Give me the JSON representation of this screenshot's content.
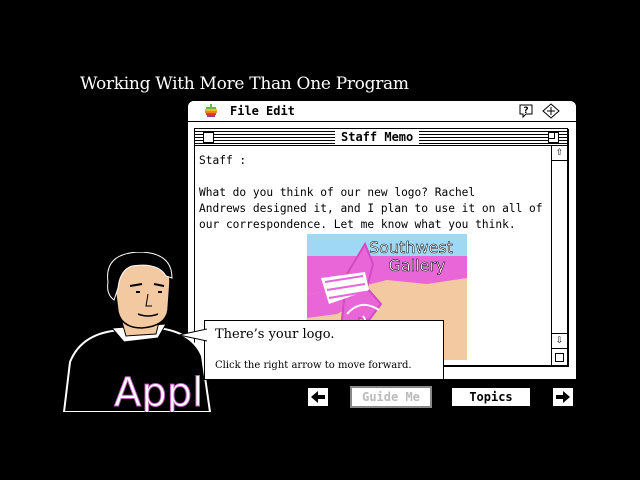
{
  "heading": "Working With More Than One Program",
  "menubar": {
    "file": "File",
    "edit": "Edit"
  },
  "document": {
    "title": "Staff Memo",
    "lines": [
      "Staff :",
      "",
      "What do you think of our new logo?  Rachel",
      "Andrews designed it, and I plan to use it on all of",
      "our correspondence.  Let me know what you think."
    ]
  },
  "logo": {
    "line1": "Southwest",
    "line2": "Gallery"
  },
  "character": {
    "shirt_text": "Appl"
  },
  "bubble": {
    "main": "There’s your logo.",
    "sub": "Click the right arrow to move forward."
  },
  "nav": {
    "guide_me": "Guide Me",
    "topics": "Topics"
  },
  "colors": {
    "logo_sky": "#9fd8f4",
    "logo_pink": "#e866d8",
    "logo_sand": "#f3c9a2",
    "background": "#000000"
  }
}
